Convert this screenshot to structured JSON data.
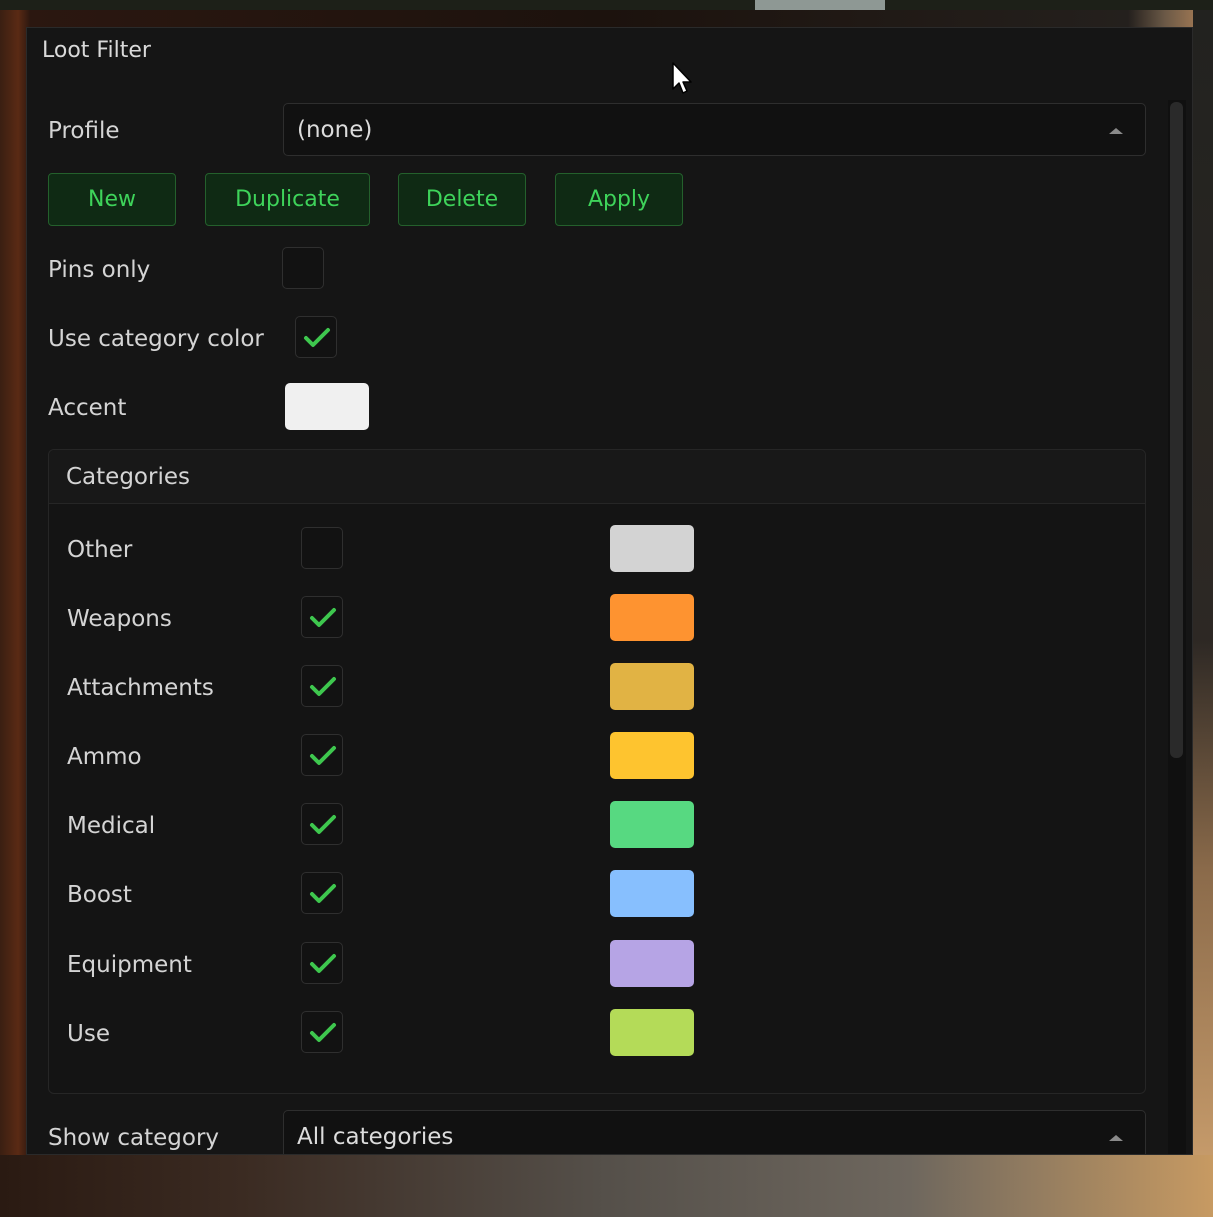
{
  "window": {
    "title": "Loot Filter"
  },
  "profile": {
    "label": "Profile",
    "value": "(none)"
  },
  "buttons": {
    "new": "New",
    "duplicate": "Duplicate",
    "delete": "Delete",
    "apply": "Apply"
  },
  "pins_only": {
    "label": "Pins only",
    "checked": false
  },
  "use_category_color": {
    "label": "Use category color",
    "checked": true
  },
  "accent": {
    "label": "Accent",
    "color": "#f0f0f0"
  },
  "categories": {
    "header": "Categories",
    "items": [
      {
        "label": "Other",
        "checked": false,
        "color": "#d3d3d3"
      },
      {
        "label": "Weapons",
        "checked": true,
        "color": "#fe9330"
      },
      {
        "label": "Attachments",
        "checked": true,
        "color": "#e1b344"
      },
      {
        "label": "Ammo",
        "checked": true,
        "color": "#fec42f"
      },
      {
        "label": "Medical",
        "checked": true,
        "color": "#57d981"
      },
      {
        "label": "Boost",
        "checked": true,
        "color": "#87bffe"
      },
      {
        "label": "Equipment",
        "checked": true,
        "color": "#b6a4e5"
      },
      {
        "label": "Use",
        "checked": true,
        "color": "#b4db58"
      }
    ]
  },
  "show_category": {
    "label": "Show category",
    "value": "All categories"
  },
  "colors": {
    "check": "#3ec74e",
    "button_text": "#3ed35a"
  }
}
